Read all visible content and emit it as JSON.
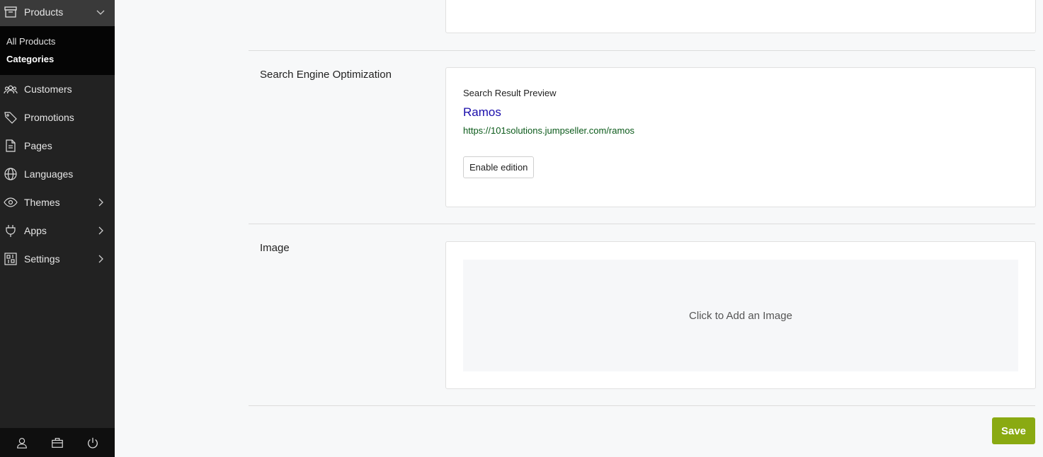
{
  "sidebar": {
    "products_label": "Products",
    "subitems": [
      "All Products",
      "Categories"
    ],
    "items": [
      {
        "label": "Customers",
        "icon": "users-icon"
      },
      {
        "label": "Promotions",
        "icon": "tag-icon"
      },
      {
        "label": "Pages",
        "icon": "page-icon"
      },
      {
        "label": "Languages",
        "icon": "globe-icon"
      },
      {
        "label": "Themes",
        "icon": "eye-icon"
      },
      {
        "label": "Apps",
        "icon": "plug-icon"
      },
      {
        "label": "Settings",
        "icon": "settings-panel-icon"
      }
    ],
    "bottom_icons": [
      "user-icon",
      "briefcase-icon",
      "power-icon"
    ]
  },
  "seo": {
    "section_label": "Search Engine Optimization",
    "preview_title": "Search Result Preview",
    "preview_name": "Ramos",
    "preview_url": "https://101solutions.jumpseller.com/ramos",
    "enable_button": "Enable edition"
  },
  "image": {
    "section_label": "Image",
    "dropzone_label": "Click to Add an Image"
  },
  "actions": {
    "save_label": "Save"
  },
  "colors": {
    "sidebar_bg": "#222222",
    "save_bg": "#8aaa12",
    "link_blue": "#1a0dab",
    "url_green": "#0b5a1a"
  }
}
